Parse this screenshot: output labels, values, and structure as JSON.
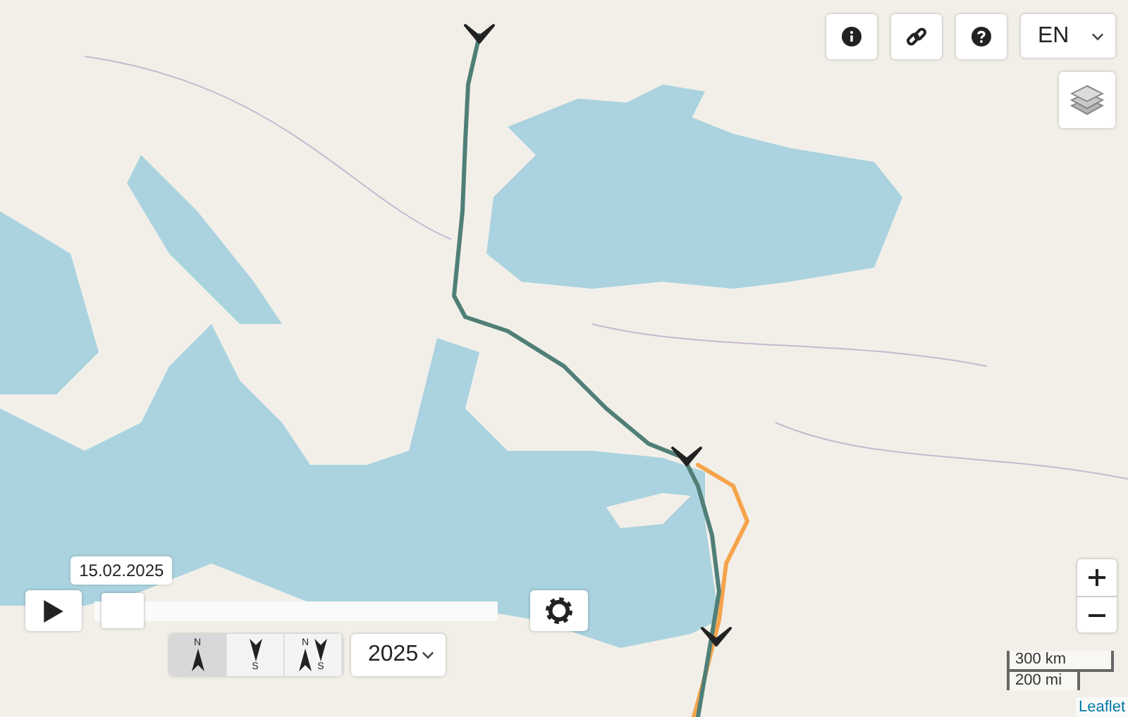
{
  "toolbar": {
    "language": "EN"
  },
  "timeline": {
    "date": "15.02.2025",
    "level": 0.02
  },
  "direction_buttons": [
    {
      "kind": "north",
      "labels": [
        "N"
      ],
      "selected": true
    },
    {
      "kind": "south",
      "labels": [
        "S"
      ],
      "selected": false
    },
    {
      "kind": "both",
      "labels": [
        "N",
        "S"
      ],
      "selected": false
    }
  ],
  "year_select": {
    "value": "2025"
  },
  "scale": {
    "metric": "300 km",
    "imperial": "200 mi"
  },
  "attribution": "Leaflet"
}
